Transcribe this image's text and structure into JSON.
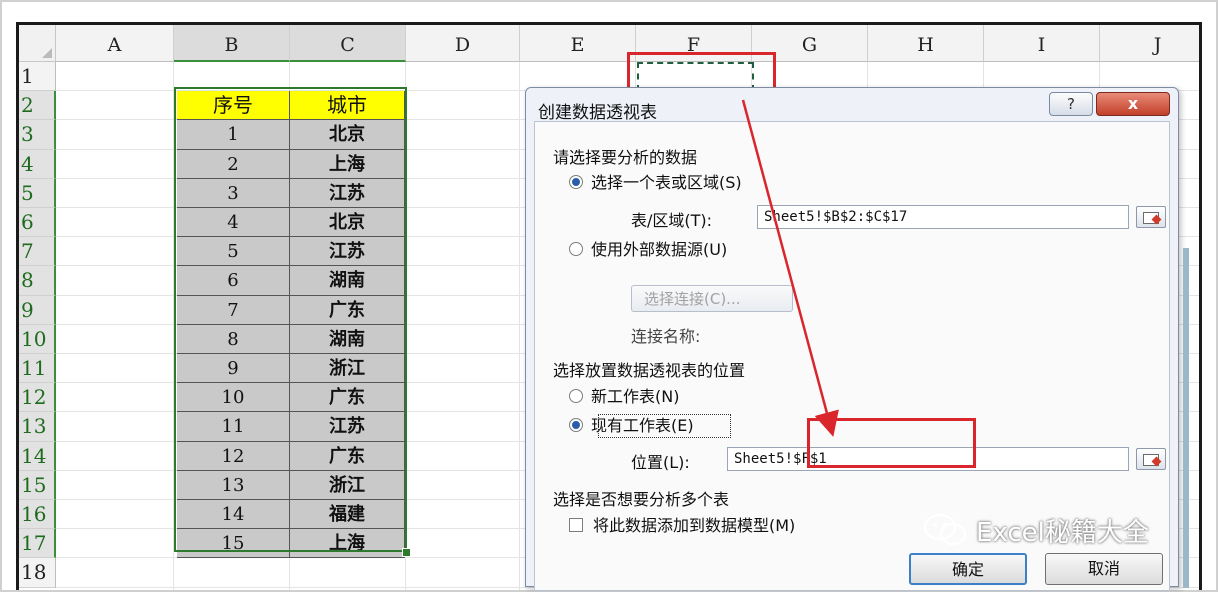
{
  "columns": [
    "A",
    "B",
    "C",
    "D",
    "E",
    "F",
    "G",
    "H",
    "I",
    "J"
  ],
  "rows": [
    "1",
    "2",
    "3",
    "4",
    "5",
    "6",
    "7",
    "8",
    "9",
    "10",
    "11",
    "12",
    "13",
    "14",
    "15",
    "16",
    "17",
    "18"
  ],
  "table": {
    "headers": [
      "序号",
      "城市"
    ],
    "rows": [
      [
        "1",
        "北京"
      ],
      [
        "2",
        "上海"
      ],
      [
        "3",
        "江苏"
      ],
      [
        "4",
        "北京"
      ],
      [
        "5",
        "江苏"
      ],
      [
        "6",
        "湖南"
      ],
      [
        "7",
        "广东"
      ],
      [
        "8",
        "湖南"
      ],
      [
        "9",
        "浙江"
      ],
      [
        "10",
        "广东"
      ],
      [
        "11",
        "江苏"
      ],
      [
        "12",
        "广东"
      ],
      [
        "13",
        "浙江"
      ],
      [
        "14",
        "福建"
      ],
      [
        "15",
        "上海"
      ]
    ]
  },
  "dialog": {
    "title": "创建数据透视表",
    "help_label": "?",
    "close_label": "x",
    "section_choose_data": "请选择要分析的数据",
    "radio_select_table": "选择一个表或区域(S)",
    "table_range_label": "表/区域(T):",
    "table_range_value": "Sheet5!$B$2:$C$17",
    "radio_external": "使用外部数据源(U)",
    "choose_connection_label": "选择连接(C)...",
    "connection_name_label": "连接名称:",
    "section_location": "选择放置数据透视表的位置",
    "radio_new_sheet": "新工作表(N)",
    "radio_existing_sheet": "现有工作表(E)",
    "location_label": "位置(L):",
    "location_value": "Sheet5!$F$1",
    "section_multi": "选择是否想要分析多个表",
    "checkbox_data_model": "将此数据添加到数据模型(M)",
    "ok_label": "确定",
    "cancel_label": "取消"
  },
  "watermark": "Excel秘籍大全",
  "colors": {
    "accent_red": "#d9262c",
    "header_yellow": "#ffff00",
    "selection_green": "#2d7a2d"
  }
}
